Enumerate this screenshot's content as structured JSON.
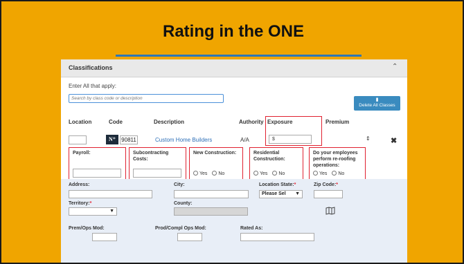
{
  "slide": {
    "title": "Rating in the ONE"
  },
  "panel": {
    "title": "Classifications",
    "enter_all_label": "Enter All that apply:",
    "search_placeholder": "Search by class code or description",
    "delete_all_label": "Delete All Classes"
  },
  "columns": {
    "location": "Location",
    "code": "Code",
    "description": "Description",
    "authority": "Authority",
    "exposure": "Exposure",
    "premium": "Premium"
  },
  "row": {
    "location_value": "",
    "logo_text": "N⁺",
    "code": "90811",
    "description": "Custom Home Builders",
    "authority": "A/A",
    "exposure_prefix": "$",
    "exposure_value": ""
  },
  "questions": {
    "payroll_label": "Payroll:",
    "subcontracting_label": "Subcontracting Costs:",
    "new_construction_label": "New Construction:",
    "residential_label": "Residential Construction:",
    "reroofing_label": "Do your employees perform re-roofing operations:",
    "yes": "Yes",
    "no": "No"
  },
  "location_form": {
    "address_label": "Address:",
    "city_label": "City:",
    "state_label": "Location State:",
    "state_value": "Please Sel",
    "zip_label": "Zip Code:",
    "territory_label": "Territory:",
    "county_label": "County:",
    "premops_label": "Prem/Ops Mod:",
    "prodcompl_label": "Prod/Compl Ops Mod:",
    "rated_as_label": "Rated As:",
    "required_mark": "*"
  },
  "colors": {
    "slide_bg": "#f0a500",
    "accent_blue": "#3a8bbf",
    "highlight_red": "#e0202f",
    "form_bg": "#e8eef7"
  }
}
